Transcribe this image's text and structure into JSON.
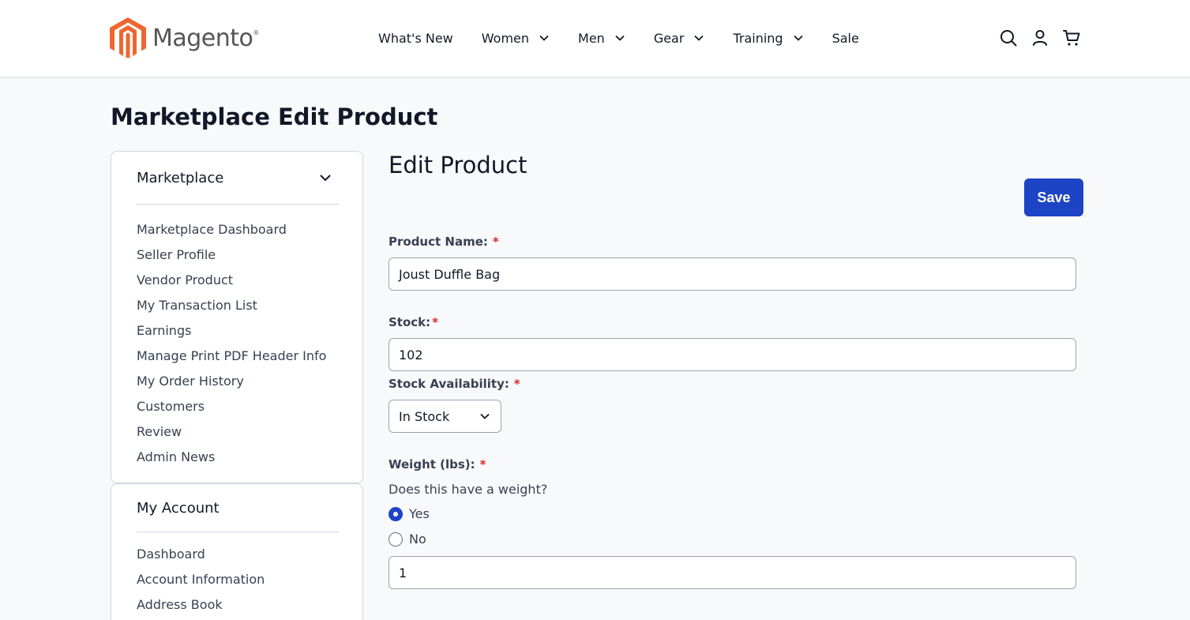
{
  "brand": {
    "name": "Magento",
    "trademark": "®",
    "logo_color": "#ee672f",
    "logo_color_dark": "#c45721"
  },
  "nav": [
    {
      "label": "What's New",
      "has_dropdown": false
    },
    {
      "label": "Women",
      "has_dropdown": true
    },
    {
      "label": "Men",
      "has_dropdown": true
    },
    {
      "label": "Gear",
      "has_dropdown": true
    },
    {
      "label": "Training",
      "has_dropdown": true
    },
    {
      "label": "Sale",
      "has_dropdown": false
    }
  ],
  "header_icons": [
    "search-icon",
    "account-icon",
    "cart-icon"
  ],
  "page_title": "Marketplace Edit Product",
  "sidebar": {
    "marketplace": {
      "title": "Marketplace",
      "items": [
        "Marketplace Dashboard",
        "Seller Profile",
        "Vendor Product",
        "My Transaction List",
        "Earnings",
        "Manage Print PDF Header Info",
        "My Order History",
        "Customers",
        "Review",
        "Admin News"
      ]
    },
    "account": {
      "title": "My Account",
      "items": [
        "Dashboard",
        "Account Information",
        "Address Book"
      ]
    }
  },
  "form": {
    "title": "Edit Product",
    "save_label": "Save",
    "accent_color": "#1d44c4",
    "product_name": {
      "label": "Product Name:",
      "required": "*",
      "value": "Joust Duffle Bag"
    },
    "stock": {
      "label": "Stock:",
      "required": "*",
      "value": "102"
    },
    "stock_availability": {
      "label": "Stock Availability:",
      "required": "*",
      "selected": "In Stock"
    },
    "weight": {
      "label": "Weight (lbs):",
      "required": "*",
      "question": "Does this have a weight?",
      "options": [
        {
          "label": "Yes",
          "checked": true
        },
        {
          "label": "No",
          "checked": false
        }
      ],
      "value": "1"
    }
  }
}
